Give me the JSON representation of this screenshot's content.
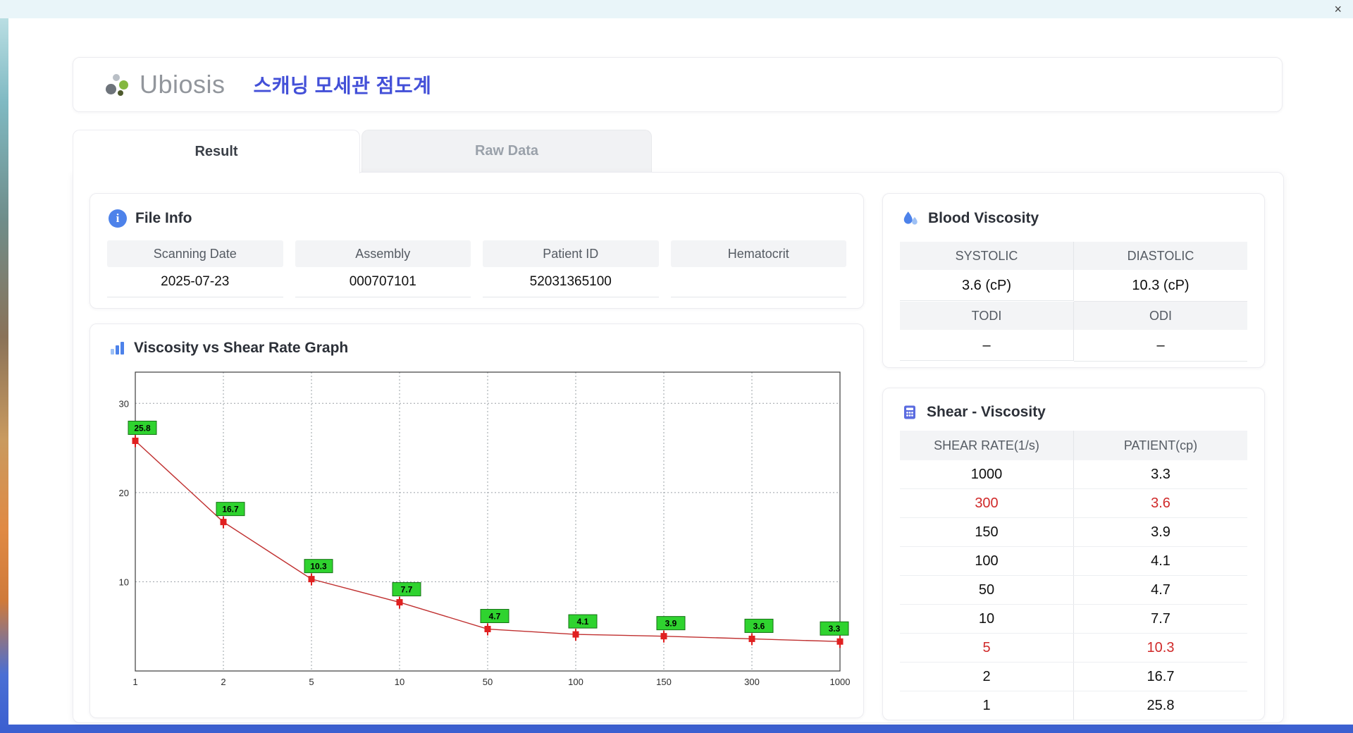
{
  "window": {
    "close_glyph": "×"
  },
  "header": {
    "logo_text": "Ubiosis",
    "title": "스캐닝 모세관 점도계"
  },
  "tabs": [
    {
      "label": "Result",
      "active": true
    },
    {
      "label": "Raw Data",
      "active": false
    }
  ],
  "file_info": {
    "title": "File Info",
    "fields": [
      {
        "label": "Scanning Date",
        "value": "2025-07-23"
      },
      {
        "label": "Assembly",
        "value": "000707101"
      },
      {
        "label": "Patient ID",
        "value": "52031365100"
      },
      {
        "label": "Hematocrit",
        "value": ""
      }
    ]
  },
  "blood_viscosity": {
    "title": "Blood Viscosity",
    "rows": [
      {
        "labels": [
          "SYSTOLIC",
          "DIASTOLIC"
        ],
        "values": [
          "3.6 (cP)",
          "10.3 (cP)"
        ]
      },
      {
        "labels": [
          "TODI",
          "ODI"
        ],
        "values": [
          "–",
          "–"
        ]
      }
    ]
  },
  "shear_viscosity": {
    "title": "Shear - Viscosity",
    "columns": [
      "SHEAR RATE(1/s)",
      "PATIENT(cp)"
    ],
    "rows": [
      {
        "shear_rate": "1000",
        "patient": "3.3",
        "highlight": false
      },
      {
        "shear_rate": "300",
        "patient": "3.6",
        "highlight": true
      },
      {
        "shear_rate": "150",
        "patient": "3.9",
        "highlight": false
      },
      {
        "shear_rate": "100",
        "patient": "4.1",
        "highlight": false
      },
      {
        "shear_rate": "50",
        "patient": "4.7",
        "highlight": false
      },
      {
        "shear_rate": "10",
        "patient": "7.7",
        "highlight": false
      },
      {
        "shear_rate": "5",
        "patient": "10.3",
        "highlight": true
      },
      {
        "shear_rate": "2",
        "patient": "16.7",
        "highlight": false
      },
      {
        "shear_rate": "1",
        "patient": "25.8",
        "highlight": false
      }
    ]
  },
  "chart_data": {
    "type": "line",
    "title": "Viscosity vs Shear Rate Graph",
    "categories": [
      1,
      2,
      5,
      10,
      50,
      100,
      150,
      300,
      1000
    ],
    "values": [
      25.8,
      16.7,
      10.3,
      7.7,
      4.7,
      4.1,
      3.9,
      3.6,
      3.3
    ],
    "xlabel": "",
    "ylabel": "",
    "yticks": [
      10,
      20,
      30
    ],
    "ylim": [
      0,
      33.5
    ],
    "x_scale": "category",
    "grid": true,
    "legend": false,
    "line_color": "#c03030",
    "marker_color": "#e02020",
    "label_bg": "#2fd32f",
    "label_border": "#167016"
  }
}
